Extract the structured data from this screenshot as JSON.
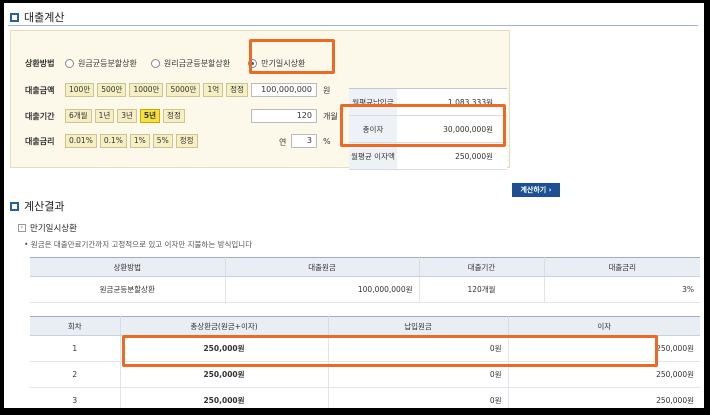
{
  "header": {
    "title": "대출계산"
  },
  "form": {
    "method": {
      "label": "상환방법",
      "options": [
        "원금균등분할상환",
        "원리금균등분할상환",
        "만기일시상환"
      ],
      "selected_index": 2
    },
    "amount": {
      "label": "대출금액",
      "chips": [
        "100만",
        "500만",
        "1000만",
        "5000만",
        "1억",
        "정정"
      ],
      "value": "100,000,000",
      "unit": "원"
    },
    "period": {
      "label": "대출기간",
      "chips": [
        "6개월",
        "1년",
        "3년",
        "5년",
        "정정"
      ],
      "active_chip_index": 3,
      "value": "120",
      "unit": "개월"
    },
    "rate": {
      "label": "대출금리",
      "chips": [
        "0.01%",
        "0.1%",
        "1%",
        "5%",
        "정정"
      ],
      "prefix": "연",
      "value": "3",
      "unit": "%"
    }
  },
  "summary": [
    {
      "label": "월평균납입금",
      "value": "1,083,333원"
    },
    {
      "label": "총이자",
      "value": "30,000,000원"
    },
    {
      "label": "월평균 이자액",
      "value": "250,000원"
    }
  ],
  "calc_button": "계산하기 ›",
  "results": {
    "title": "계산결과",
    "subtitle": "만기일시상환",
    "subtitle_arrow": "›",
    "note": "• 원금은 대출만료기간까지 고정적으로 있고 이자만 지불하는 방식입니다",
    "info_table": {
      "headers": [
        "상환방법",
        "대출원금",
        "대출기간",
        "대출금리"
      ],
      "row": [
        "원금균등분할상환",
        "100,000,000원",
        "120개월",
        "3%"
      ]
    },
    "schedule_table": {
      "headers": [
        "회차",
        "총상환금(원금+이자)",
        "납입원금",
        "이자"
      ],
      "rows": [
        [
          "1",
          "250,000원",
          "0원",
          "250,000원"
        ],
        [
          "2",
          "250,000원",
          "0원",
          "250,000원"
        ],
        [
          "3",
          "250,000원",
          "0원",
          "250,000원"
        ]
      ]
    }
  },
  "colors": {
    "highlight": "#ec6a24",
    "accent": "#1c4f93",
    "panel_bg": "#fdf9ea"
  }
}
